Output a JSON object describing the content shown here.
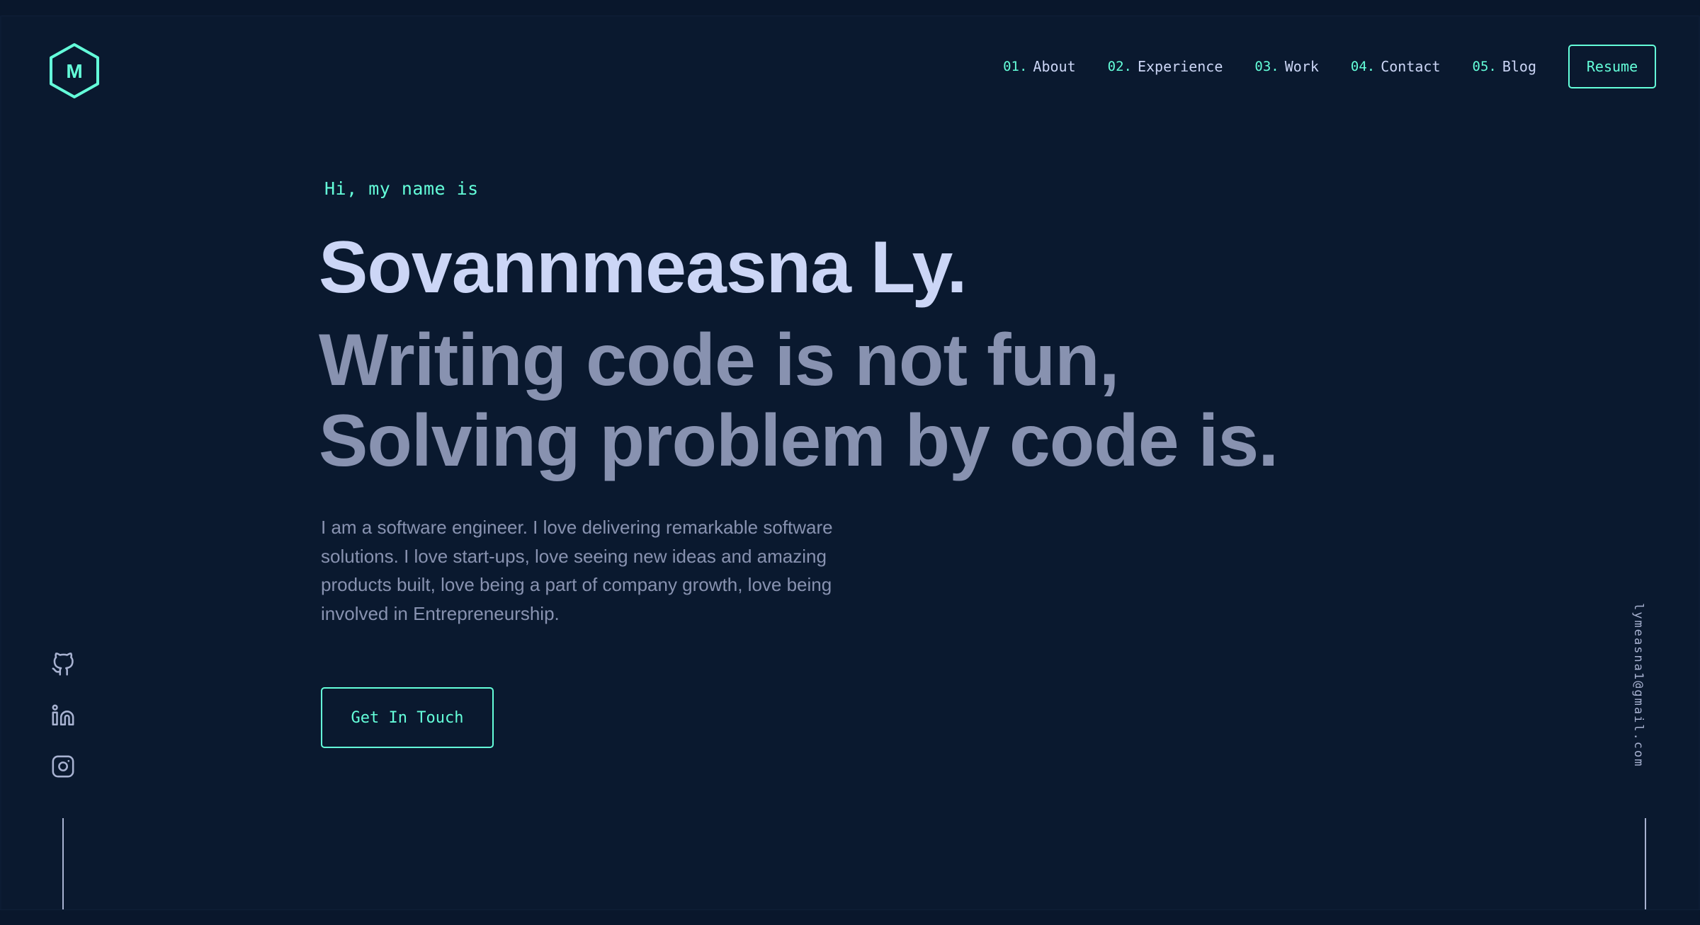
{
  "colors": {
    "background": "#0a192f",
    "accent": "#64ffda",
    "heading": "#ccd6f6",
    "body_text": "#8892b0",
    "light_slate": "#a8b2d1"
  },
  "logo": {
    "letter": "M",
    "icon": "hexagon-logo-icon"
  },
  "nav": {
    "items": [
      {
        "number": "01.",
        "label": "About"
      },
      {
        "number": "02.",
        "label": "Experience"
      },
      {
        "number": "03.",
        "label": "Work"
      },
      {
        "number": "04.",
        "label": "Contact"
      },
      {
        "number": "05.",
        "label": "Blog"
      }
    ],
    "resume_label": "Resume"
  },
  "hero": {
    "greeting": "Hi, my name is",
    "name": "Sovannmeasna Ly.",
    "tagline_line1": "Writing code is not fun,",
    "tagline_line2": "Solving problem by code is.",
    "description": "I am a software engineer. I love delivering remarkable software solutions. I love start-ups, love seeing new ideas and amazing products built, love being a part of company growth, love being involved in Entrepreneurship.",
    "cta_label": "Get In Touch"
  },
  "socials": {
    "icons": [
      "github-icon",
      "linkedin-icon",
      "instagram-icon"
    ]
  },
  "email": {
    "address": "lymeasna1@gmail.com"
  }
}
